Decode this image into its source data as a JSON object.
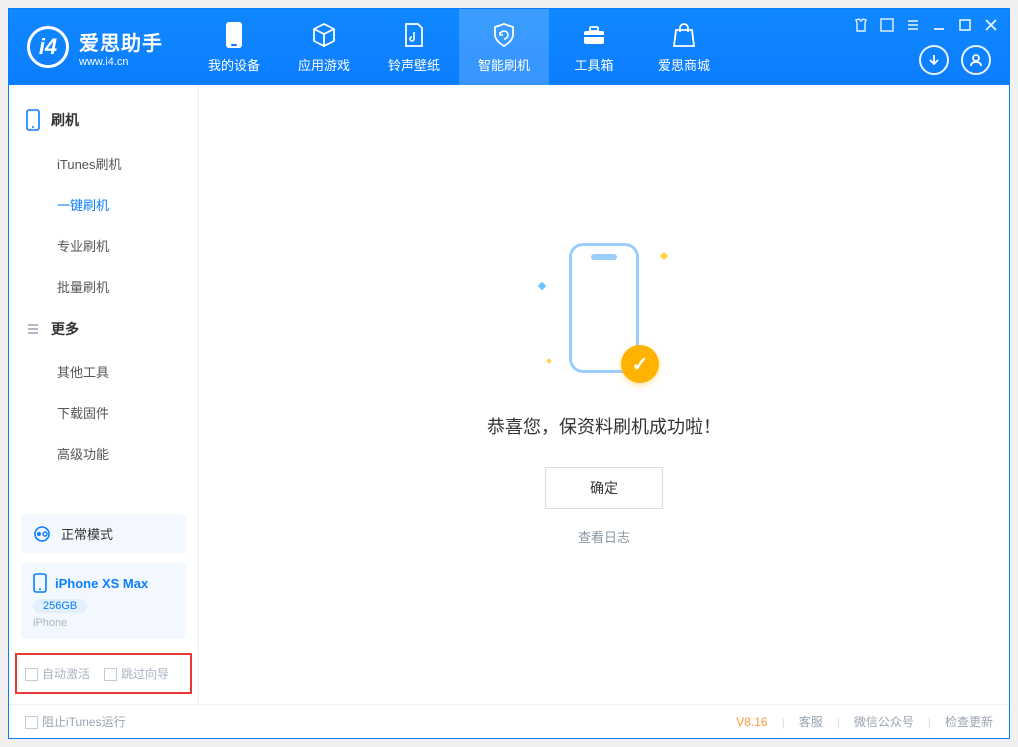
{
  "app": {
    "title": "爱思助手",
    "subtitle": "www.i4.cn"
  },
  "nav": {
    "tabs": [
      {
        "label": "我的设备"
      },
      {
        "label": "应用游戏"
      },
      {
        "label": "铃声壁纸"
      },
      {
        "label": "智能刷机"
      },
      {
        "label": "工具箱"
      },
      {
        "label": "爱思商城"
      }
    ]
  },
  "sidebar": {
    "group1_title": "刷机",
    "group1_items": [
      "iTunes刷机",
      "一键刷机",
      "专业刷机",
      "批量刷机"
    ],
    "group2_title": "更多",
    "group2_items": [
      "其他工具",
      "下载固件",
      "高级功能"
    ],
    "mode_label": "正常模式",
    "device_name": "iPhone XS Max",
    "device_capacity": "256GB",
    "device_type": "iPhone",
    "checkbox1": "自动激活",
    "checkbox2": "跳过向导"
  },
  "main": {
    "success_msg": "恭喜您，保资料刷机成功啦！",
    "ok_label": "确定",
    "log_link": "查看日志"
  },
  "status": {
    "block_itunes": "阻止iTunes运行",
    "version": "V8.16",
    "support": "客服",
    "wechat": "微信公众号",
    "update": "检查更新"
  }
}
